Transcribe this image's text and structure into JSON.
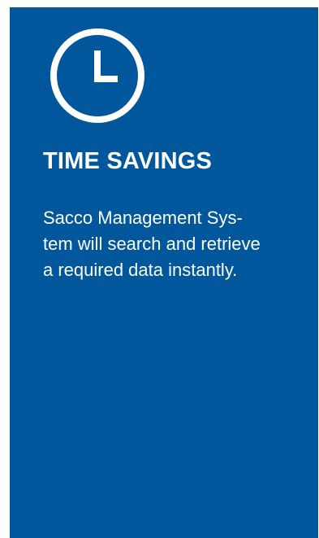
{
  "colors": {
    "card_background": "#01579B",
    "text": "#FFFFFF"
  },
  "card": {
    "icon": "clock-icon",
    "title": "TIME SAVINGS",
    "description_lines": [
      "Sacco Management Sys-",
      "tem will search and retrieve",
      "a required data instantly."
    ]
  }
}
